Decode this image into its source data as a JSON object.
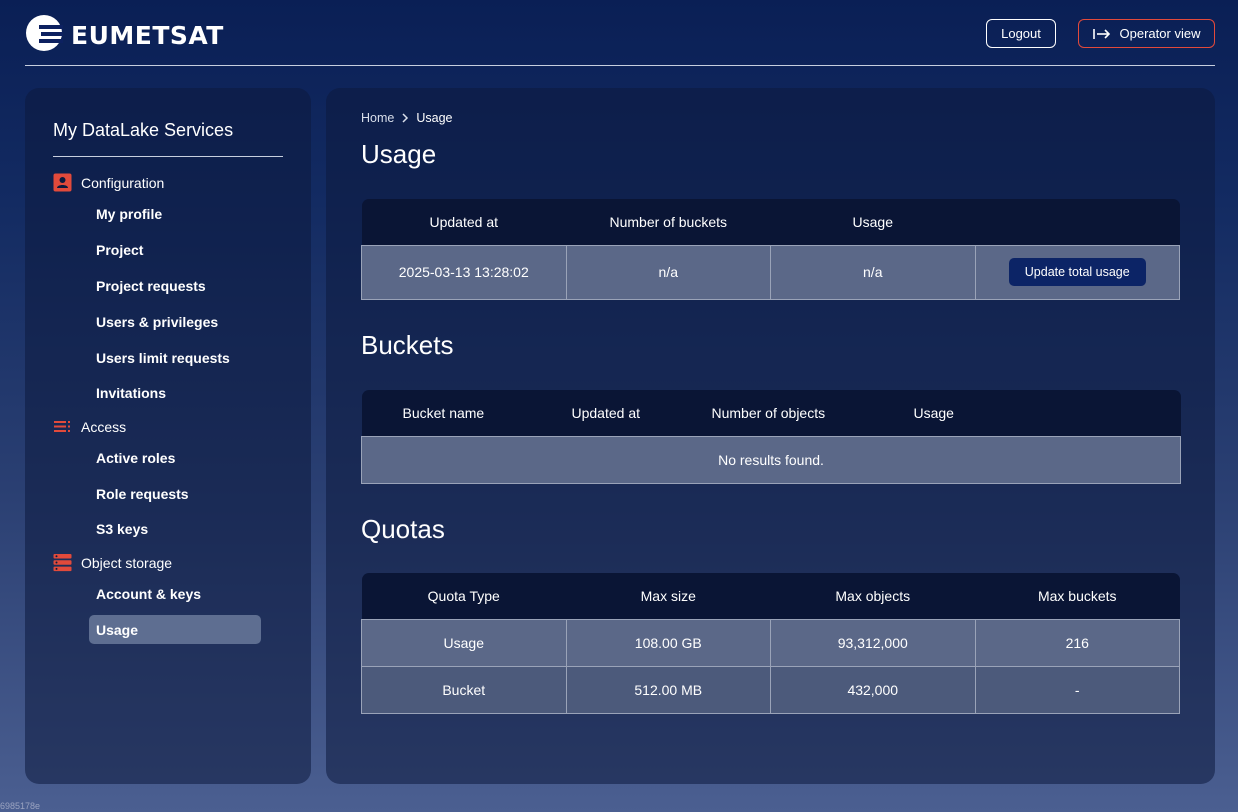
{
  "header": {
    "logo_text": "EUMETSAT",
    "logout_label": "Logout",
    "operator_label": "Operator view",
    "operator_icon": "arrow-right-to-bar-icon"
  },
  "sidebar": {
    "title": "My DataLake Services",
    "sections": [
      {
        "label": "Configuration",
        "icon": "user-badge-icon",
        "items": [
          {
            "label": "My profile"
          },
          {
            "label": "Project"
          },
          {
            "label": "Project requests"
          },
          {
            "label": "Users & privileges"
          },
          {
            "label": "Users limit requests"
          },
          {
            "label": "Invitations"
          }
        ]
      },
      {
        "label": "Access",
        "icon": "list-icon",
        "items": [
          {
            "label": "Active roles"
          },
          {
            "label": "Role requests"
          },
          {
            "label": "S3 keys"
          }
        ]
      },
      {
        "label": "Object storage",
        "icon": "server-stack-icon",
        "items": [
          {
            "label": "Account & keys"
          },
          {
            "label": "Usage",
            "active": true
          }
        ]
      }
    ]
  },
  "breadcrumb": {
    "home": "Home",
    "current": "Usage"
  },
  "usage": {
    "title": "Usage",
    "columns": [
      "Updated at",
      "Number of buckets",
      "Usage",
      ""
    ],
    "row": {
      "updated_at": "2025-03-13 13:28:02",
      "buckets": "n/a",
      "usage": "n/a"
    },
    "update_button": "Update total usage"
  },
  "buckets": {
    "title": "Buckets",
    "columns": [
      "Bucket name",
      "Updated at",
      "Number of objects",
      "Usage"
    ],
    "empty_text": "No results found."
  },
  "quotas": {
    "title": "Quotas",
    "columns": [
      "Quota Type",
      "Max size",
      "Max objects",
      "Max buckets"
    ],
    "rows": [
      {
        "type": "Usage",
        "max_size": "108.00 GB",
        "max_objects": "93,312,000",
        "max_buckets": "216"
      },
      {
        "type": "Bucket",
        "max_size": "512.00 MB",
        "max_objects": "432,000",
        "max_buckets": "-"
      }
    ]
  },
  "footer": {
    "build_hash": "6985178e"
  },
  "colors": {
    "accent_orange": "#e24a3b",
    "primary_button": "#0c2466"
  }
}
